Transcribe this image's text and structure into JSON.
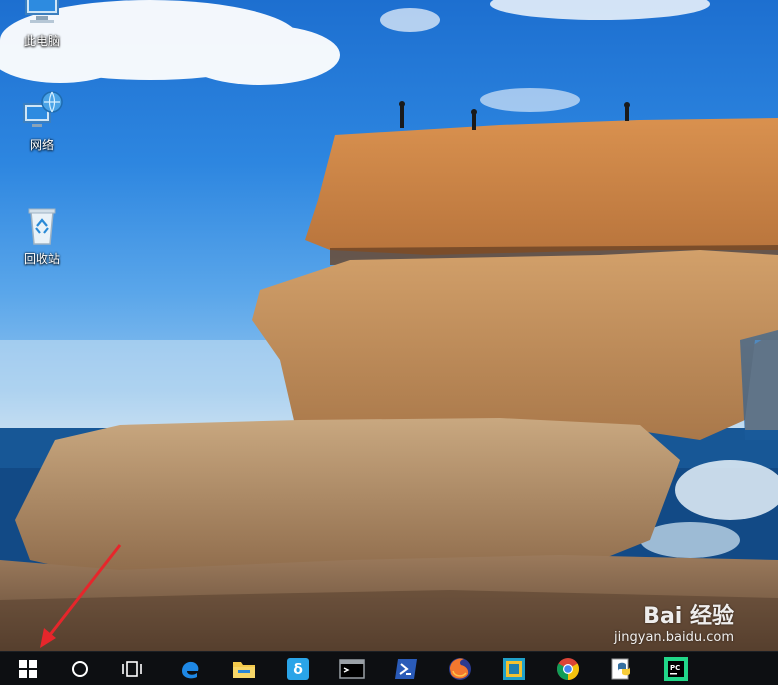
{
  "desktop": {
    "icons": [
      {
        "label": "此电脑",
        "icon": "computer-icon"
      },
      {
        "label": "网络",
        "icon": "network-icon"
      },
      {
        "label": "回收站",
        "icon": "recycle-bin-icon"
      }
    ]
  },
  "taskbar": {
    "buttons": [
      {
        "icon": "windows-start-icon"
      },
      {
        "icon": "cortana-search-icon"
      },
      {
        "icon": "task-view-icon"
      },
      {
        "icon": "edge-browser-icon"
      },
      {
        "icon": "file-explorer-icon"
      },
      {
        "icon": "app-icon"
      },
      {
        "icon": "command-prompt-icon"
      },
      {
        "icon": "powershell-icon"
      },
      {
        "icon": "firefox-icon"
      },
      {
        "icon": "app-tile-icon"
      },
      {
        "icon": "chrome-icon"
      },
      {
        "icon": "python-icon"
      },
      {
        "icon": "pycharm-icon"
      }
    ]
  },
  "watermark": {
    "logo": "Bai 经验",
    "url": "jingyan.baidu.com"
  },
  "colors": {
    "sky": "#2d86e0",
    "sea": "#114a85",
    "rock": "#c98a4e",
    "taskbar": "#0d0f12",
    "arrow": "#e6262b"
  }
}
